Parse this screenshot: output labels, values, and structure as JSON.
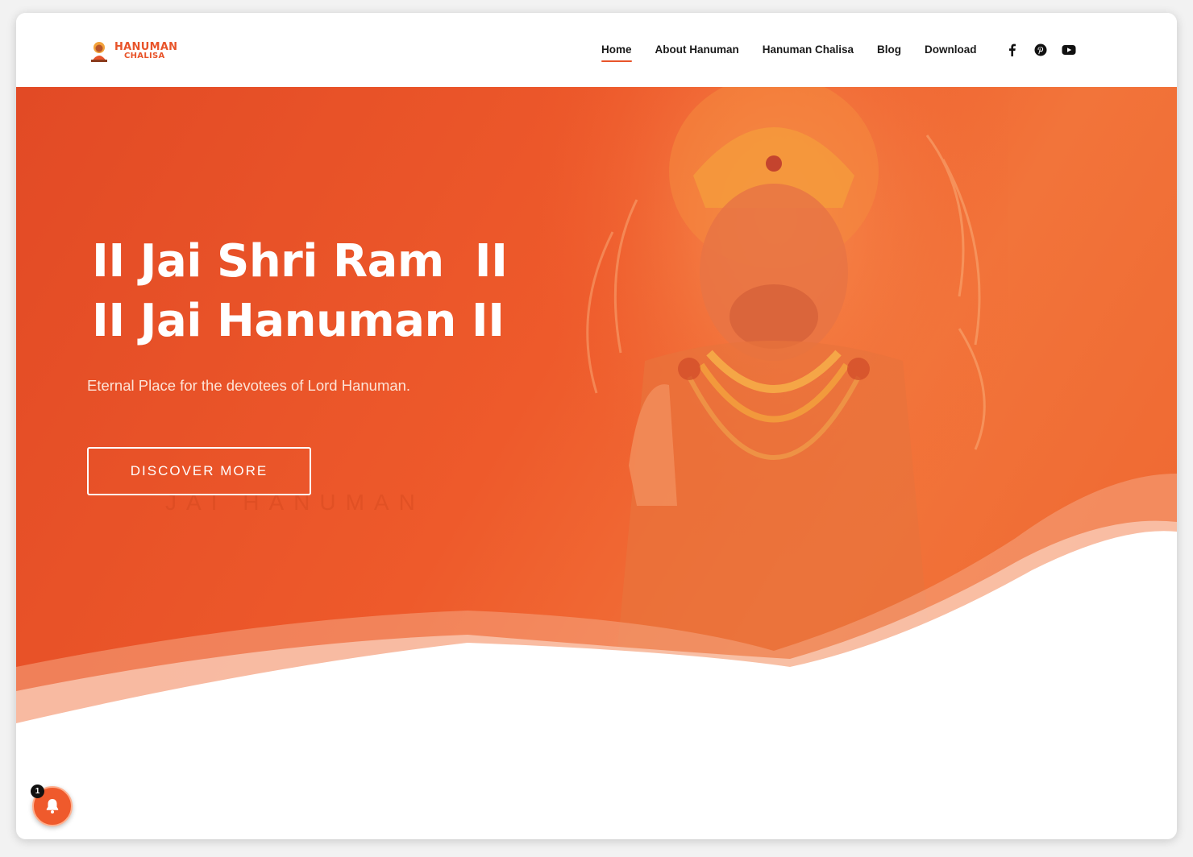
{
  "logo": {
    "line1": "HANUMAN",
    "line2": "CHALISA",
    "icon": "hanuman-logo-icon"
  },
  "nav": {
    "items": [
      {
        "label": "Home",
        "active": true
      },
      {
        "label": "About Hanuman",
        "active": false
      },
      {
        "label": "Hanuman Chalisa",
        "active": false
      },
      {
        "label": "Blog",
        "active": false
      },
      {
        "label": "Download",
        "active": false
      }
    ]
  },
  "socials": [
    "facebook-icon",
    "pinterest-icon",
    "youtube-icon"
  ],
  "hero": {
    "line1": "II Jai Shri Ram  II",
    "line2": "II Jai Hanuman II",
    "tagline": "Eternal Place for the devotees of Lord Hanuman.",
    "button": "DISCOVER MORE",
    "watermark": "JAI HANUMAN"
  },
  "notification": {
    "count": "1",
    "icon": "bell-icon"
  },
  "colors": {
    "accent": "#e8542a",
    "hero_start": "#e24a25",
    "hero_end": "#f2743a"
  }
}
